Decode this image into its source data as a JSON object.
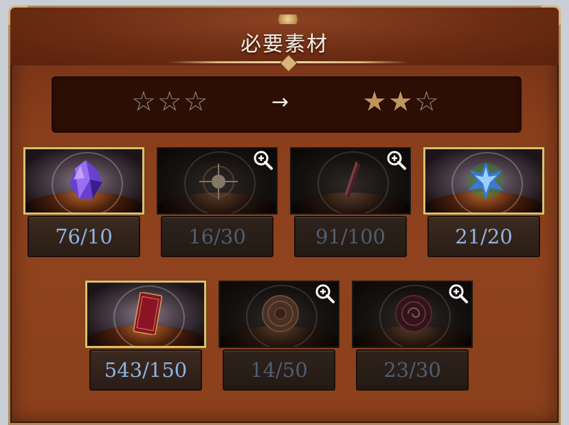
{
  "title": "必要素材",
  "rank": {
    "before_stars": [
      "☆",
      "☆",
      "☆"
    ],
    "arrow": "→",
    "after_stars": [
      "★",
      "★",
      "☆"
    ]
  },
  "materials": [
    {
      "name": "purple-crystal",
      "count": "76/10",
      "owned": true
    },
    {
      "name": "light-orb",
      "count": "16/30",
      "owned": false
    },
    {
      "name": "red-shard",
      "count": "91/100",
      "owned": false
    },
    {
      "name": "blue-crystal",
      "count": "21/20",
      "owned": true
    },
    {
      "name": "red-ticket",
      "count": "543/150",
      "owned": true
    },
    {
      "name": "bronze-seal",
      "count": "14/50",
      "owned": false
    },
    {
      "name": "red-seal",
      "count": "23/30",
      "owned": false
    }
  ],
  "colors": {
    "count_sufficient": "#8fb4e6",
    "count_insufficient": "#4f5e72",
    "gold_frame": "#e0be6e",
    "panel": "#8a3e1b"
  },
  "icons": {
    "zoom": "zoom-in-icon"
  }
}
